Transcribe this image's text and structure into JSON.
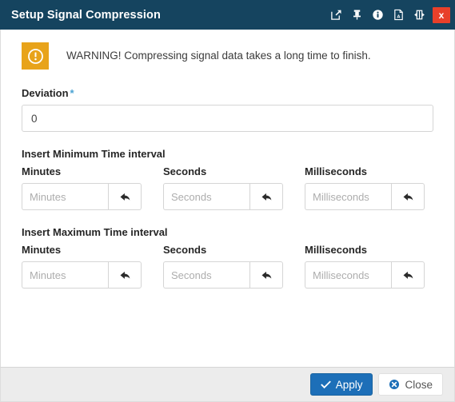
{
  "titlebar": {
    "title": "Setup Signal Compression",
    "tools": [
      {
        "name": "popout-icon",
        "label": "Open in new window"
      },
      {
        "name": "pin-icon",
        "label": "Pin"
      },
      {
        "name": "info-icon",
        "label": "Information"
      },
      {
        "name": "pdf-icon",
        "label": "Export PDF"
      },
      {
        "name": "collapse-icon",
        "label": "Collapse panel"
      }
    ],
    "close_label": "x"
  },
  "warning": {
    "icon": "exclamation-circle-icon",
    "text": "WARNING! Compressing signal data takes a long time to finish.",
    "bg_color": "#e8a31a"
  },
  "deviation": {
    "label": "Deviation",
    "required_marker": "*",
    "value": "0",
    "placeholder": ""
  },
  "sections": [
    {
      "title": "Insert Minimum Time interval",
      "fields": [
        {
          "label": "Minutes",
          "placeholder": "Minutes",
          "value": "",
          "reset_icon": "undo-arrow-icon"
        },
        {
          "label": "Seconds",
          "placeholder": "Seconds",
          "value": "",
          "reset_icon": "undo-arrow-icon"
        },
        {
          "label": "Milliseconds",
          "placeholder": "Milliseconds",
          "value": "",
          "reset_icon": "undo-arrow-icon"
        }
      ]
    },
    {
      "title": "Insert Maximum Time interval",
      "fields": [
        {
          "label": "Minutes",
          "placeholder": "Minutes",
          "value": "",
          "reset_icon": "undo-arrow-icon"
        },
        {
          "label": "Seconds",
          "placeholder": "Seconds",
          "value": "",
          "reset_icon": "undo-arrow-icon"
        },
        {
          "label": "Milliseconds",
          "placeholder": "Milliseconds",
          "value": "",
          "reset_icon": "undo-arrow-icon"
        }
      ]
    }
  ],
  "footer": {
    "apply_label": "Apply",
    "apply_icon": "check-icon",
    "close_label": "Close",
    "close_icon": "times-circle-icon"
  },
  "colors": {
    "titlebar": "#15445f",
    "close_red": "#e8402a",
    "warning_orange": "#e8a31a",
    "primary_blue": "#1d6fb8",
    "required_star": "#4ba3d3",
    "footer_bg": "#ececec"
  }
}
